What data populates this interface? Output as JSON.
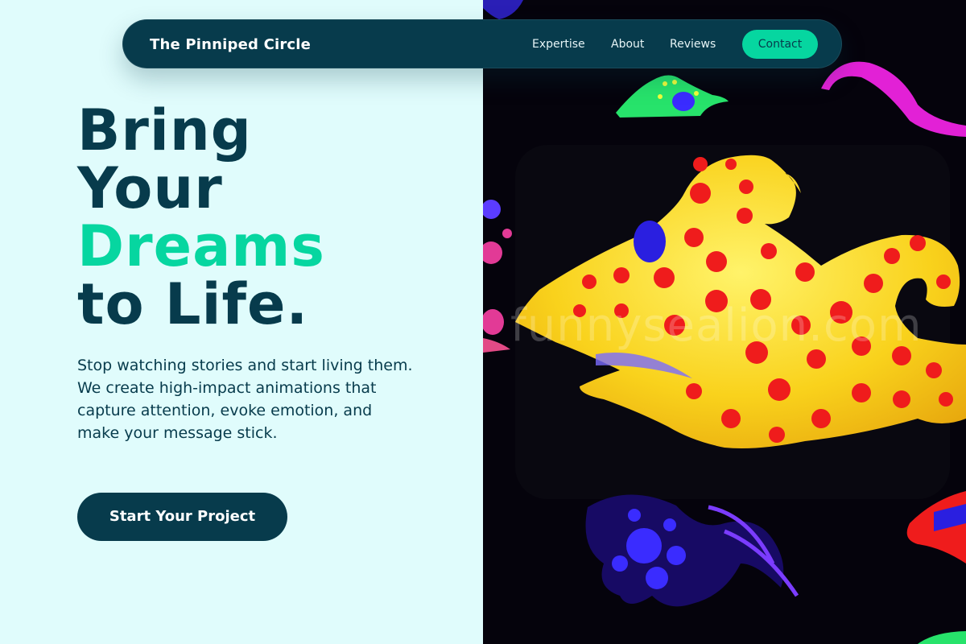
{
  "nav": {
    "brand": "The Pinniped Circle",
    "links": [
      "Expertise",
      "About",
      "Reviews"
    ],
    "contact_label": "Contact"
  },
  "hero": {
    "headline_line1": "Bring",
    "headline_line2": "Your",
    "headline_accent": "Dreams",
    "headline_line4": "to Life.",
    "subcopy": "Stop watching stories and start living them. We create high-impact animations that capture attention, evoke emotion, and make your message stick.",
    "cta_label": "Start Your Project"
  },
  "image": {
    "watermark": "funnysealion.com",
    "subject": "yellow creature with red polka dots under black light"
  },
  "colors": {
    "navy": "#073b4c",
    "accent": "#06d6a0",
    "background": "#e0fbfc",
    "creature_yellow": "#f9d21c",
    "spots_red": "#ef1c1c"
  },
  "icons": []
}
